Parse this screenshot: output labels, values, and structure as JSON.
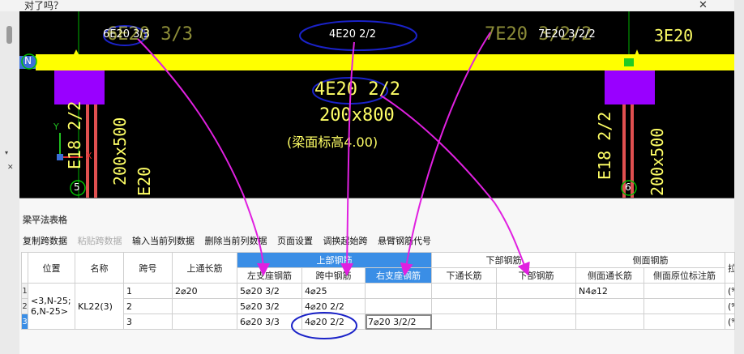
{
  "window": {
    "title": "对了吗？",
    "close": "✕"
  },
  "left_strip": {
    "arrow": "▾",
    "close": "✕"
  },
  "cad": {
    "labels": {
      "top_left_small": "6E20 3/3",
      "top_left_large": "6E20 3/3",
      "top_mid_small": "4E20 2/2",
      "top_right_large": "7E20 3/2/2",
      "top_right_small": "7E20 3/2/2",
      "top_far_right": "3E20",
      "axis_n": "N",
      "mid_4e20": "4E20 2/2",
      "mid_size": "200x800",
      "mid_elev": "(梁面标高4.00)",
      "col_left_rebar": "E18 2/2",
      "col_left_size": "200x500",
      "col_left_extra": "E20",
      "col_right_rebar": "E18 2/2",
      "col_right_size": "200x500",
      "axis_5": "5",
      "axis_6": "6",
      "ucs_y": "Y",
      "ucs_x": "X"
    },
    "colors": {
      "background": "#000000",
      "beam": "#ffff00",
      "column": "#9900ff",
      "text": "#ffffff",
      "annotation": "#e020e0",
      "circle": "#1a22c8",
      "axis_line": "#00c000"
    }
  },
  "panel": {
    "title": "梁平法表格",
    "toolbar": {
      "copy": "复制跨数据",
      "paste": "粘贴跨数据",
      "input_col": "输入当前列数据",
      "delete_col": "删除当前列数据",
      "page_setup": "页面设置",
      "swap_span": "调换起始跨",
      "cantilever": "悬臂钢筋代号"
    },
    "headers": {
      "position": "位置",
      "name": "名称",
      "span": "跨号",
      "top_through": "上通长筋",
      "top_group": "上部钢筋",
      "left_support": "左支座钢筋",
      "mid_span": "跨中钢筋",
      "right_support": "右支座钢筋",
      "bottom_group": "下部钢筋",
      "bottom_through": "下通长筋",
      "bottom_rebar": "下部钢筋",
      "side_group": "侧面钢筋",
      "side_through": "侧面通长筋",
      "side_orig": "侧面原位标注筋",
      "extra": "拉"
    },
    "rows": [
      {
        "no": "1",
        "span": "1",
        "top_through": "2⌀20",
        "left_support": "5⌀20 3/2",
        "mid_span": "4⌀25",
        "right_support": "",
        "bottom_through": "",
        "bottom_rebar": "",
        "side_through": "N4⌀12",
        "side_orig": "",
        "extra": "(⁹"
      },
      {
        "no": "2",
        "span": "2",
        "top_through": "",
        "left_support": "5⌀20 3/2",
        "mid_span": "4⌀20 2/2",
        "right_support": "",
        "bottom_through": "",
        "bottom_rebar": "",
        "side_through": "",
        "side_orig": "",
        "extra": "(⁹"
      },
      {
        "no": "3",
        "span": "3",
        "top_through": "",
        "left_support": "6⌀20 3/3",
        "mid_span": "4⌀20 2/2",
        "right_support": "7⌀20 3/2/2",
        "bottom_through": "",
        "bottom_rebar": "",
        "side_through": "",
        "side_orig": "",
        "extra": "(⁹"
      }
    ],
    "merged": {
      "position": "<3,N-25; 6,N-25>",
      "name": "KL22(3)"
    }
  }
}
